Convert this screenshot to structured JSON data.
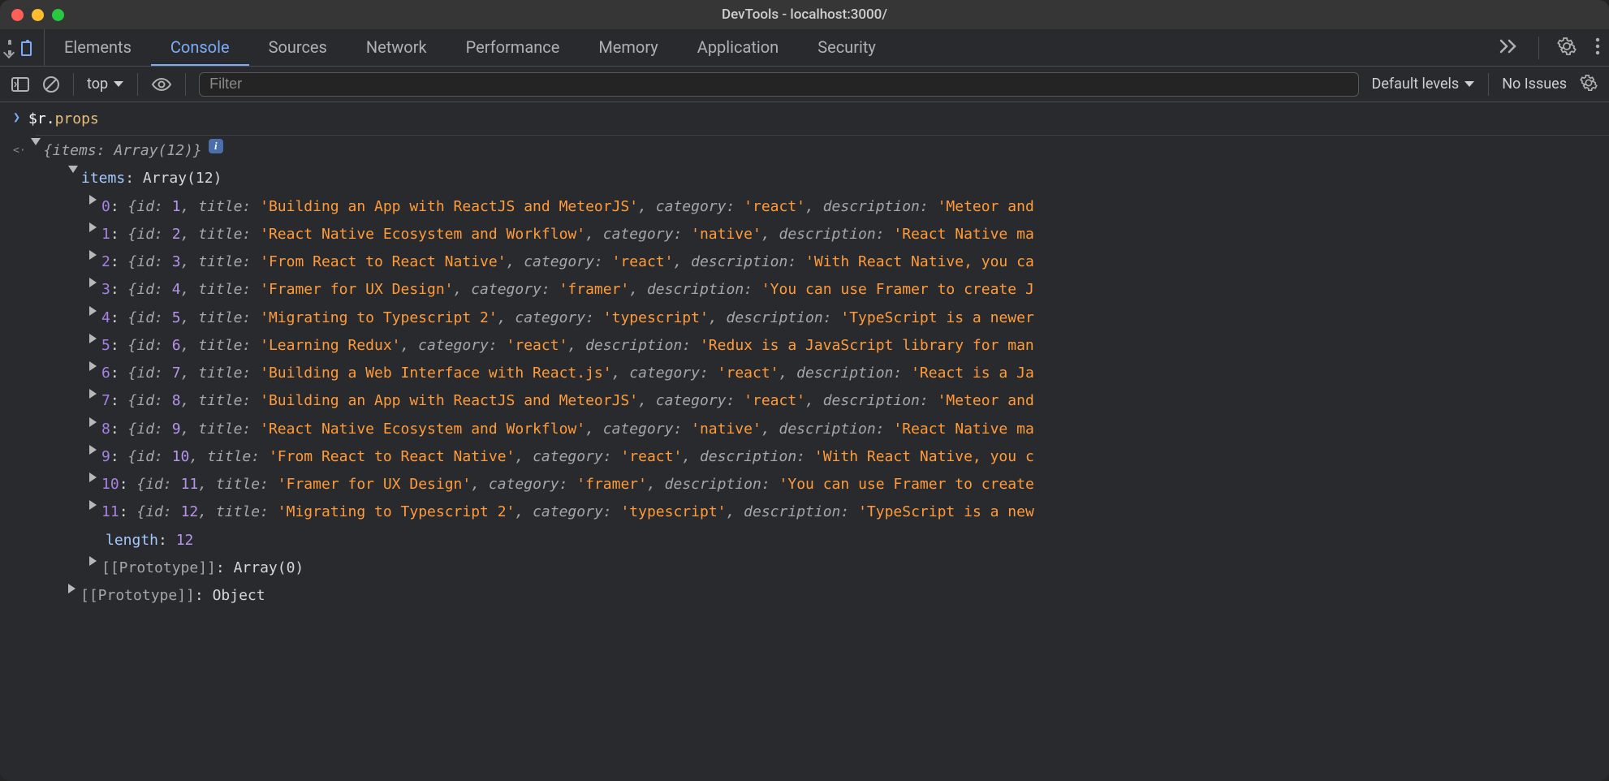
{
  "title": "DevTools - localhost:3000/",
  "tabs": {
    "elements": "Elements",
    "console": "Console",
    "sources": "Sources",
    "network": "Network",
    "performance": "Performance",
    "memory": "Memory",
    "application": "Application",
    "security": "Security"
  },
  "toolbar": {
    "context": "top",
    "filter_placeholder": "Filter",
    "levels": "Default levels",
    "issues": "No Issues"
  },
  "input_expr": {
    "obj": "$r",
    "dot": ".",
    "prop": "props"
  },
  "summary": {
    "open": "{",
    "items": "items",
    "colon": ": ",
    "type": "Array(12)",
    "close": "}"
  },
  "items_header": {
    "label": "items",
    "colon": ": ",
    "type": "Array(12)"
  },
  "array_items": [
    {
      "index": "0",
      "id": 1,
      "title": "Building an App with ReactJS and MeteorJS",
      "category": "react",
      "description": "Meteor and"
    },
    {
      "index": "1",
      "id": 2,
      "title": "React Native Ecosystem and Workflow",
      "category": "native",
      "description": "React Native ma"
    },
    {
      "index": "2",
      "id": 3,
      "title": "From React to React Native",
      "category": "react",
      "description": "With React Native, you ca"
    },
    {
      "index": "3",
      "id": 4,
      "title": "Framer for UX Design",
      "category": "framer",
      "description": "You can use Framer to create J"
    },
    {
      "index": "4",
      "id": 5,
      "title": "Migrating to Typescript 2",
      "category": "typescript",
      "description": "TypeScript is a newer"
    },
    {
      "index": "5",
      "id": 6,
      "title": "Learning Redux",
      "category": "react",
      "description": "Redux is a JavaScript library for man"
    },
    {
      "index": "6",
      "id": 7,
      "title": "Building a Web Interface with React.js",
      "category": "react",
      "description": "React is a Ja"
    },
    {
      "index": "7",
      "id": 8,
      "title": "Building an App with ReactJS and MeteorJS",
      "category": "react",
      "description": "Meteor and"
    },
    {
      "index": "8",
      "id": 9,
      "title": "React Native Ecosystem and Workflow",
      "category": "native",
      "description": "React Native ma"
    },
    {
      "index": "9",
      "id": 10,
      "title": "From React to React Native",
      "category": "react",
      "description": "With React Native, you c"
    },
    {
      "index": "10",
      "id": 11,
      "title": "Framer for UX Design",
      "category": "framer",
      "description": "You can use Framer to create"
    },
    {
      "index": "11",
      "id": 12,
      "title": "Migrating to Typescript 2",
      "category": "typescript",
      "description": "TypeScript is a new"
    }
  ],
  "length": {
    "label": "length",
    "colon": ": ",
    "value": "12"
  },
  "proto_arr": {
    "label": "[[Prototype]]",
    "colon": ": ",
    "value": "Array(0)"
  },
  "proto_obj": {
    "label": "[[Prototype]]",
    "colon": ": ",
    "value": "Object"
  }
}
